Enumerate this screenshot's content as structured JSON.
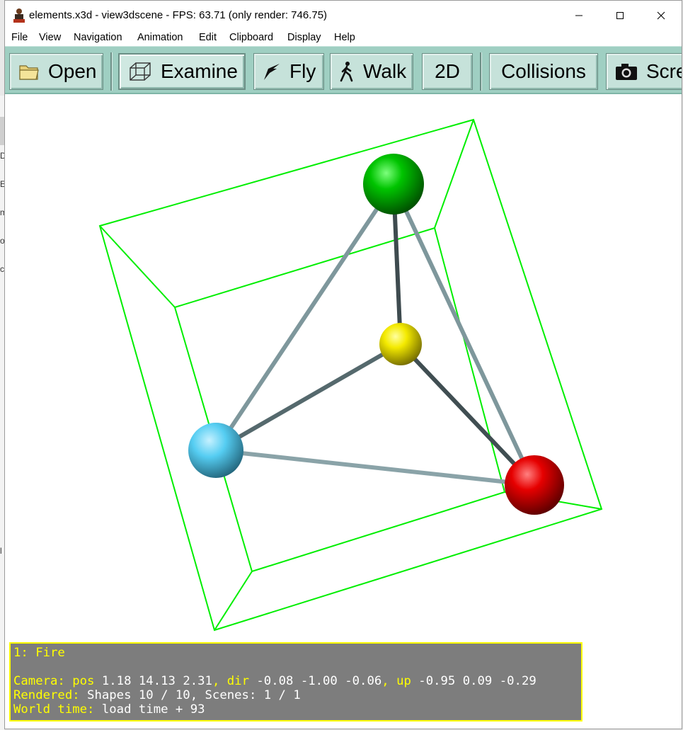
{
  "window": {
    "title": "elements.x3d - view3dscene - FPS: 63.71 (only render: 746.75)"
  },
  "left_edge_fragments": [
    "D",
    "E",
    "m",
    "ot",
    "c)",
    "l"
  ],
  "menu": [
    "File",
    "View",
    "Navigation",
    "Animation",
    "Edit",
    "Clipboard",
    "Display",
    "Help"
  ],
  "toolbar": {
    "open": "Open",
    "examine": "Examine",
    "fly": "Fly",
    "walk": "Walk",
    "two_d": "2D",
    "collisions": "Collisions",
    "screenshot": "Scre"
  },
  "scene": {
    "atoms": [
      {
        "name": "green-atom",
        "color": "#00b400"
      },
      {
        "name": "yellow-atom",
        "color": "#f0e600"
      },
      {
        "name": "cyan-atom",
        "color": "#4fc8ef"
      },
      {
        "name": "red-atom",
        "color": "#e00000"
      }
    ],
    "bond_color": "#6f8a8f",
    "box_color": "#00ee00"
  },
  "hud": {
    "viewpoint": "1: Fire",
    "camera_label": "Camera:",
    "pos_label": "pos",
    "pos": "1.18 14.13 2.31",
    "dir_label": "dir",
    "dir": "-0.08 -1.00 -0.06",
    "up_label": "up",
    "up": "-0.95 0.09 -0.29",
    "rendered_label": "Rendered:",
    "rendered": "Shapes 10 / 10, Scenes: 1 / 1",
    "world_time_label": "World time:",
    "world_time": "load time + 93"
  }
}
